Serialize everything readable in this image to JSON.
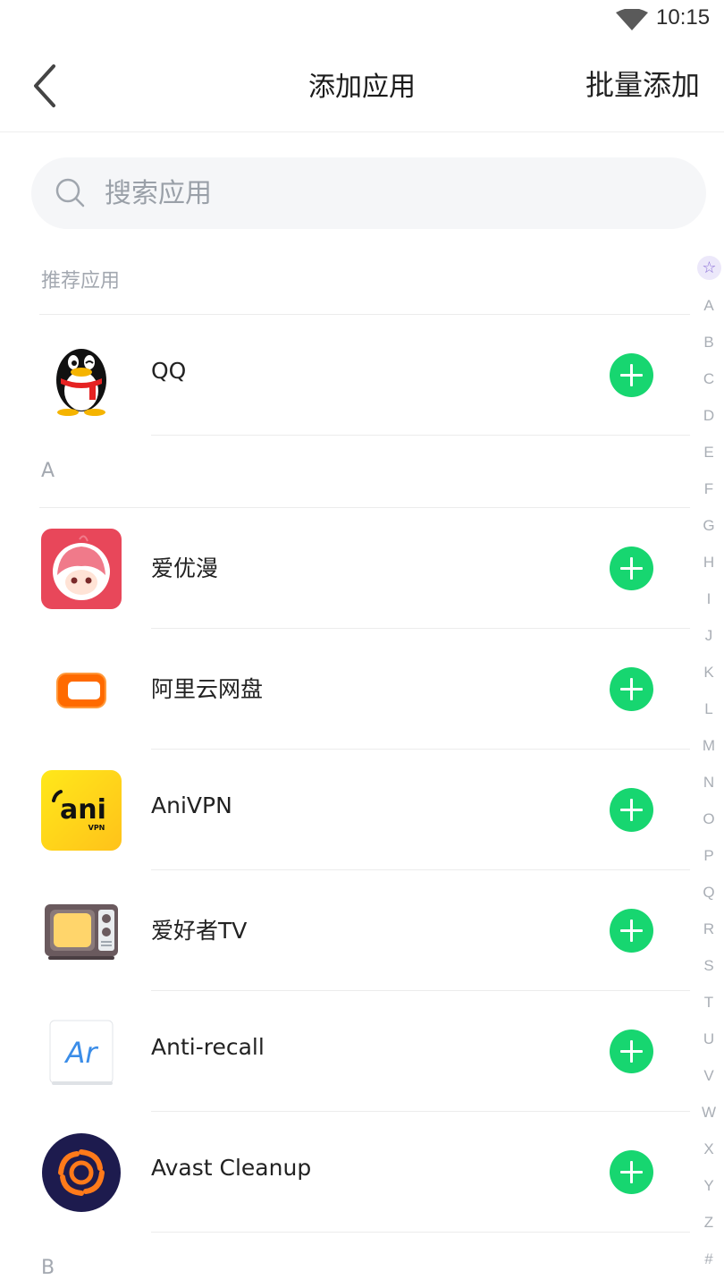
{
  "status_bar": {
    "time": "10:15",
    "wifi_icon": "wifi-icon"
  },
  "header": {
    "title": "添加应用",
    "batch_add": "批量添加",
    "back_icon": "back-arrow-icon"
  },
  "search": {
    "placeholder": "搜索应用",
    "icon": "search-icon"
  },
  "sections": {
    "recommended": "推荐应用",
    "a": "A",
    "b": "B"
  },
  "apps": [
    {
      "name": "QQ",
      "icon": "qq-penguin-icon"
    },
    {
      "name": "爱优漫",
      "icon": "aiyouman-icon"
    },
    {
      "name": "阿里云网盘",
      "icon": "aliyun-drive-icon"
    },
    {
      "name": "AniVPN",
      "icon": "anivpn-icon",
      "icon_text": "ani",
      "icon_subtext": "VPN"
    },
    {
      "name": "爱好者TV",
      "icon": "tv-icon"
    },
    {
      "name": "Anti-recall",
      "icon": "anti-recall-icon",
      "icon_text": "Ar"
    },
    {
      "name": "Avast Cleanup",
      "icon": "avast-cleanup-icon"
    }
  ],
  "add_button_icon": "plus-icon",
  "index_bar": {
    "star": "☆",
    "letters": [
      "A",
      "B",
      "C",
      "D",
      "E",
      "F",
      "G",
      "H",
      "I",
      "J",
      "K",
      "L",
      "M",
      "N",
      "O",
      "P",
      "Q",
      "R",
      "S",
      "T",
      "U",
      "V",
      "W",
      "X",
      "Y",
      "Z",
      "#"
    ]
  },
  "colors": {
    "accent_green": "#17d670",
    "muted_text": "#a3a8b0",
    "search_bg": "#f5f6f8"
  }
}
